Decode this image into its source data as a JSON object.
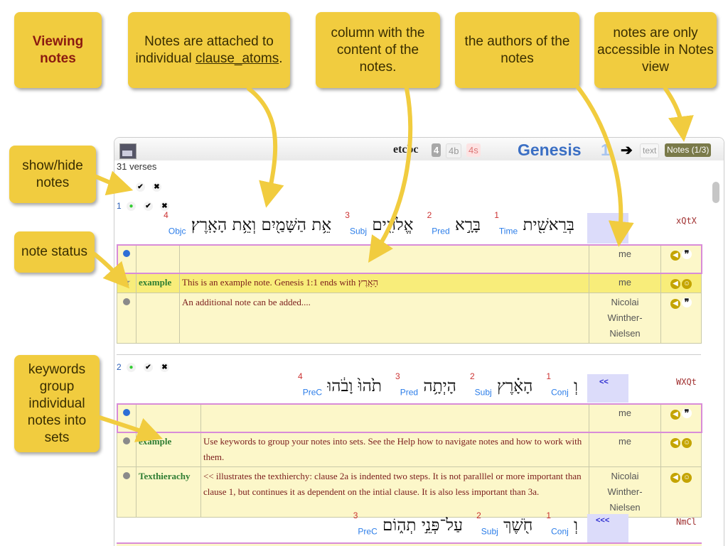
{
  "callouts": {
    "viewing": [
      "Viewing",
      "notes"
    ],
    "attached": "Notes are attached to individual ",
    "attached_link": "clause_atoms",
    "attached_end": ".",
    "column": "column with the content of the notes.",
    "authors": "the authors of the notes",
    "accessible": "notes are only accessible in Notes view",
    "showhide": "show/hide notes",
    "status": "note status",
    "keywords": "keywords group individual notes into sets"
  },
  "app": {
    "logo": "etcbc",
    "versions": [
      "4",
      "4b",
      "4s"
    ],
    "book": "Genesis",
    "chapter": "1",
    "next_arrow": "➔",
    "view_text": "text",
    "view_notes": "Notes (1/3)",
    "verse_count": "31 verses"
  },
  "verse1": {
    "num": "1",
    "words": [
      {
        "heb": "בְּרֵאשִׁ֖ית",
        "n": "1",
        "fn": "Time"
      },
      {
        "heb": "בָּרָ֣א",
        "n": "2",
        "fn": "Pred"
      },
      {
        "heb": "אֱלֹהִ֑ים",
        "n": "3",
        "fn": "Subj"
      },
      {
        "heb": "אֵ֥ת הַשָּׁמַ֖יִם וְאֵ֥ת הָאָֽרֶץ׃",
        "n": "4",
        "fn": "Objc"
      }
    ],
    "code": "xQtX",
    "notes": [
      {
        "status": "blue",
        "keyword": "",
        "text": "",
        "author": [
          "me"
        ],
        "edit": true
      },
      {
        "status": "star",
        "keyword": "example",
        "text": "This is an example note. Genesis 1:1 ends with הָאָֽרֶץ׃",
        "author": [
          "me"
        ],
        "highlight": true
      },
      {
        "status": "grey",
        "keyword": "",
        "text": "An additional note can be added....",
        "author": [
          "Nicolai",
          "Winther-",
          "Nielsen"
        ]
      }
    ]
  },
  "verse2": {
    "num": "2",
    "words": [
      {
        "heb": "וְ",
        "n": "1",
        "fn": "Conj"
      },
      {
        "heb": "הָאָ֗רֶץ",
        "n": "2",
        "fn": "Subj"
      },
      {
        "heb": "הָיְתָ֥ה",
        "n": "3",
        "fn": "Pred"
      },
      {
        "heb": "תֹ֙הוּ֙ וָבֹ֔הוּ",
        "n": "4",
        "fn": "PreC"
      }
    ],
    "code": "WXQt",
    "indent": "<<",
    "notes": [
      {
        "status": "blue",
        "keyword": "",
        "text": "",
        "author": [
          "me"
        ],
        "edit": true
      },
      {
        "status": "grey",
        "keyword": "example",
        "text": "Use keywords to group your notes into sets. See the Help how to navigate notes and how to work with them.",
        "author": [
          "me"
        ]
      },
      {
        "status": "grey",
        "keyword": "Texthierachy",
        "text": "<< illustrates the texthierchy: clause 2a is indented two steps. It is not paralllel or more important than clause 1, but continues it as dependent on the intial clause. It is also less important than 3a.",
        "author": [
          "Nicolai",
          "Winther-",
          "Nielsen"
        ]
      }
    ]
  },
  "verse2b": {
    "words": [
      {
        "heb": "וְ",
        "n": "1",
        "fn": "Conj"
      },
      {
        "heb": "חֹ֖שֶׁךְ",
        "n": "2",
        "fn": "Subj"
      },
      {
        "heb": "עַל־פְּנֵ֣י תְה֑וֹם",
        "n": "3",
        "fn": "PreC"
      }
    ],
    "code": "NmCl",
    "indent": "<<<"
  },
  "colors": {
    "callout": "#f1cc3f",
    "accent_blue": "#3b6fc4",
    "note_bg": "#fcf7c9",
    "note_hl": "#f8ed7a"
  }
}
